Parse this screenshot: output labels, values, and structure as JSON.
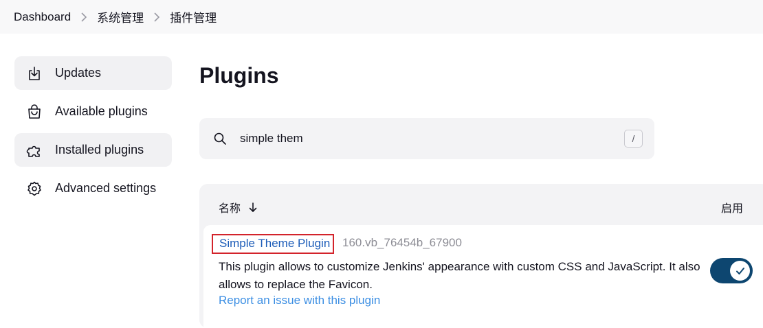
{
  "breadcrumb": {
    "items": [
      "Dashboard",
      "系统管理",
      "插件管理"
    ]
  },
  "sidebar": {
    "items": [
      {
        "label": "Updates",
        "icon": "download-icon"
      },
      {
        "label": "Available plugins",
        "icon": "shopping-bag-icon"
      },
      {
        "label": "Installed plugins",
        "icon": "puzzle-icon",
        "active": true
      },
      {
        "label": "Advanced settings",
        "icon": "gear-icon"
      }
    ]
  },
  "main": {
    "title": "Plugins",
    "search": {
      "value": "simple them",
      "shortcut": "/"
    },
    "table": {
      "col_name": "名称",
      "col_enabled": "启用",
      "rows": [
        {
          "name": "Simple Theme Plugin",
          "version": "160.vb_76454b_67900",
          "description": "This plugin allows to customize Jenkins' appearance with custom CSS and JavaScript. It also allows to replace the Favicon.",
          "report_link": "Report an issue with this plugin",
          "enabled": true
        }
      ]
    }
  },
  "colors": {
    "accent": "#1c5cb8",
    "toggle_on": "#0d4670",
    "highlight_border": "#d3232b"
  }
}
